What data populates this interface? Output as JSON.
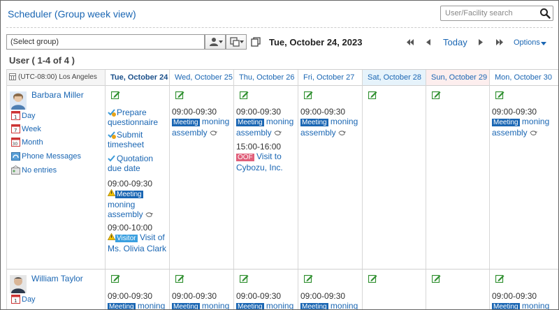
{
  "header": {
    "title": "Scheduler (Group week view)",
    "search_placeholder": "User/Facility search"
  },
  "toolbar": {
    "group_select": "(Select group)",
    "current_date": "Tue, October 24, 2023",
    "today": "Today",
    "options": "Options",
    "user_count": "User ( 1-4 of 4 )"
  },
  "grid": {
    "timezone": "(UTC-08:00) Los Angeles",
    "days": [
      "Tue, October 24",
      "Wed, October 25",
      "Thu, October 26",
      "Fri, October 27",
      "Sat, October 28",
      "Sun, October 29",
      "Mon, October 30"
    ],
    "colors": {
      "today_bg": "#ffffff",
      "sat_bg": "#e6f3fb",
      "sun_bg": "#fdeeee",
      "link": "#1a66b3"
    }
  },
  "users": [
    {
      "name": "Barbara Miller",
      "links": [
        "Day",
        "Week",
        "Month",
        "Phone Messages",
        "No entries"
      ],
      "todos": [
        "Prepare questionnaire",
        "Submit timesheet",
        "Quotation due date"
      ],
      "tue_entries": [
        {
          "time": "09:00-09:30",
          "badge": "Meeting",
          "title": "moning assembly"
        },
        {
          "time": "09:00-10:00",
          "badge": "Visitor",
          "title": "Visit of Ms. Olivia Clark"
        }
      ],
      "wed_entry": {
        "time": "09:00-09:30",
        "badge": "Meeting",
        "title": "moning assembly"
      },
      "thu_entries": [
        {
          "time": "09:00-09:30",
          "badge": "Meeting",
          "title": "moning assembly"
        },
        {
          "time": "15:00-16:00",
          "badge": "OOF",
          "title": "Visit to Cybozu, Inc."
        }
      ],
      "fri_entry": {
        "time": "09:00-09:30",
        "badge": "Meeting",
        "title": "moning assembly"
      },
      "mon_entry": {
        "time": "09:00-09:30",
        "badge": "Meeting",
        "title": "moning assembly"
      }
    },
    {
      "name": "William Taylor",
      "links": [
        "Day"
      ],
      "time": "09:00-09:30",
      "badge": "Meeting",
      "title": "moning"
    }
  ]
}
